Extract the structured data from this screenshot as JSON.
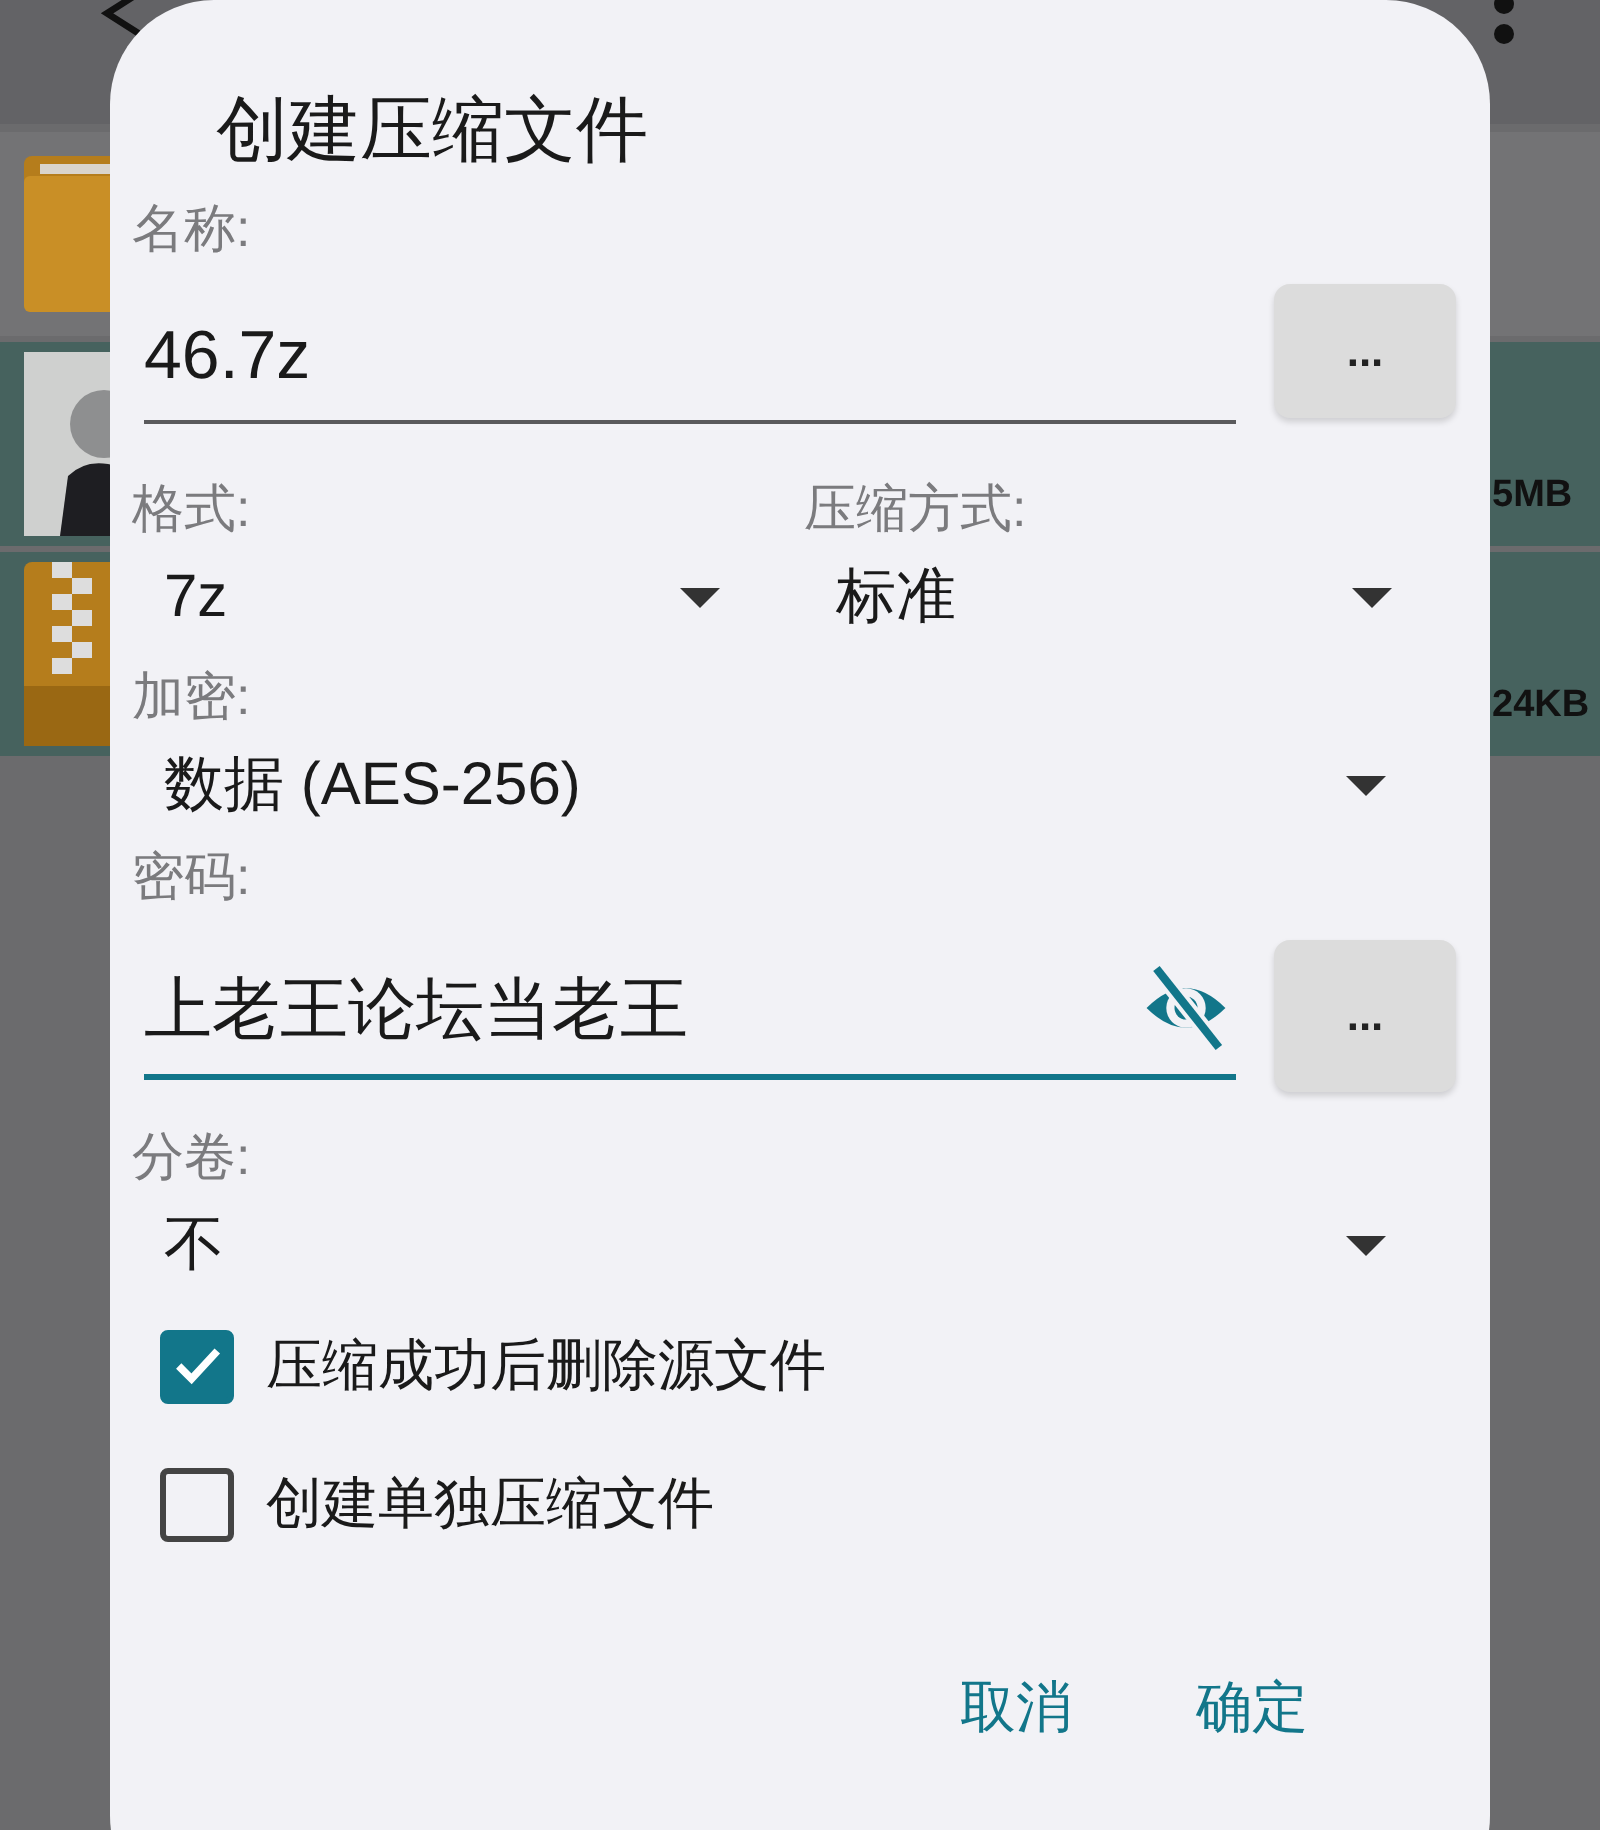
{
  "file_list": [
    {
      "kind": "folder",
      "selected": false
    },
    {
      "selected": true,
      "size": "5MB"
    },
    {
      "kind": "archive",
      "selected": true,
      "size": "24KB"
    }
  ],
  "dialog": {
    "title": "创建压缩文件",
    "name": {
      "label": "名称:",
      "value": "46.7z",
      "button": "...",
      "focused": false
    },
    "format": {
      "label": "格式:",
      "value": "7z"
    },
    "method": {
      "label": "压缩方式:",
      "value": "标准"
    },
    "encryption": {
      "label": "加密:",
      "value": "数据 (AES-256)"
    },
    "password": {
      "label": "密码:",
      "value": "上老王论坛当老王",
      "button": "...",
      "focused": true
    },
    "split": {
      "label": "分卷:",
      "value": "不"
    },
    "options": [
      {
        "label": "压缩成功后删除源文件",
        "checked": true
      },
      {
        "label": "创建单独压缩文件",
        "checked": false
      }
    ],
    "buttons": [
      "取消",
      "确定"
    ]
  }
}
